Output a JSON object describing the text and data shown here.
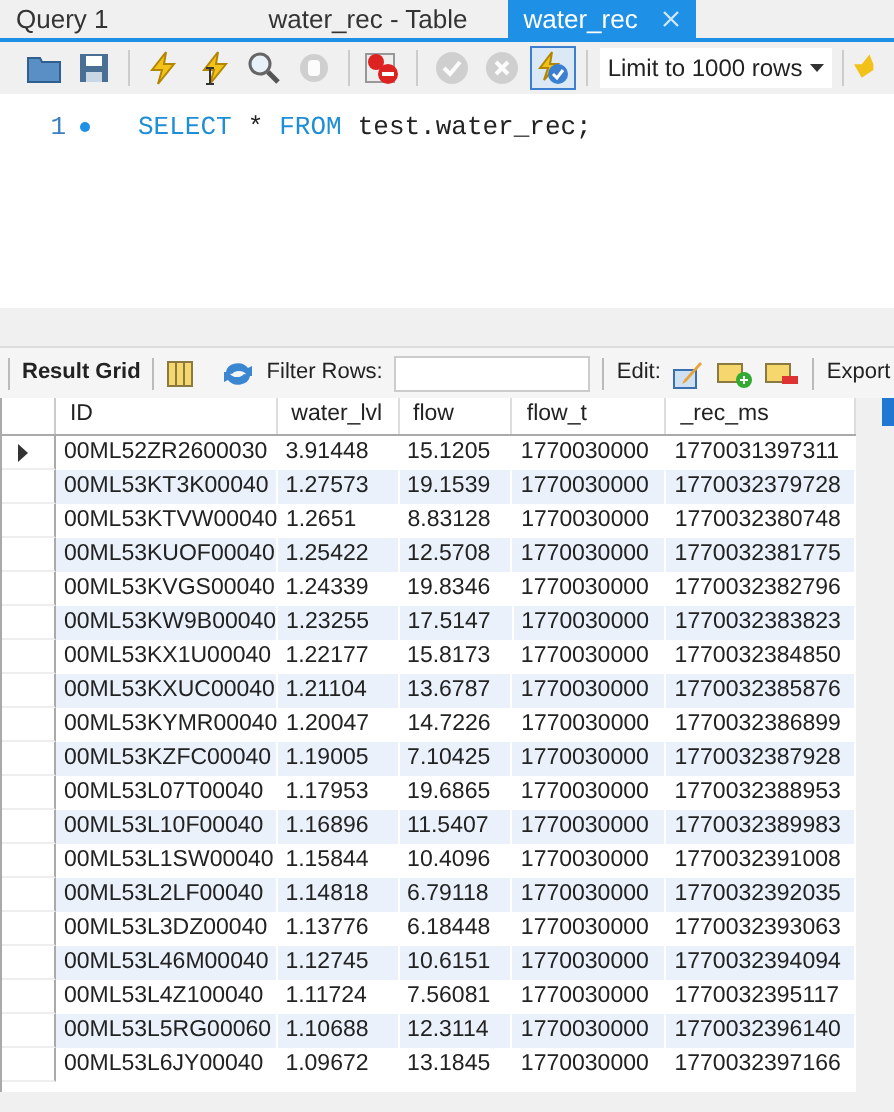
{
  "tabs": [
    {
      "label": "Query 1",
      "selected": false,
      "closable": false
    },
    {
      "label": "water_rec - Table",
      "selected": false,
      "closable": false
    },
    {
      "label": "water_rec",
      "selected": true,
      "closable": true
    }
  ],
  "toolbar": [
    {
      "kind": "folder",
      "disabled": false,
      "selected": false
    },
    {
      "kind": "save",
      "disabled": false,
      "selected": false
    },
    {
      "kind": "sep"
    },
    {
      "kind": "execute",
      "disabled": false,
      "selected": false
    },
    {
      "kind": "execute-current",
      "disabled": false,
      "selected": false
    },
    {
      "kind": "explain",
      "disabled": false,
      "selected": false
    },
    {
      "kind": "stop",
      "disabled": true,
      "selected": false
    },
    {
      "kind": "sep"
    },
    {
      "kind": "error-toggle",
      "disabled": false,
      "selected": false
    },
    {
      "kind": "sep"
    },
    {
      "kind": "commit",
      "disabled": true,
      "selected": false
    },
    {
      "kind": "rollback",
      "disabled": true,
      "selected": false
    },
    {
      "kind": "autocommit",
      "disabled": false,
      "selected": true
    },
    {
      "kind": "sep"
    }
  ],
  "limit_dropdown": {
    "value": "Limit to 1000 rows"
  },
  "editor": {
    "lines": [
      {
        "number": "1",
        "tokens": [
          {
            "text": "SELECT",
            "kind": "keyword"
          },
          {
            "text": "*",
            "kind": "plain"
          },
          {
            "text": "FROM",
            "kind": "keyword"
          },
          {
            "text": "test.water_rec;",
            "kind": "plain"
          }
        ]
      }
    ]
  },
  "result_toolbar": {
    "result_grid": "Result Grid",
    "filter_label": "Filter Rows:",
    "edit_label": "Edit:",
    "export_label": "Export"
  },
  "table": {
    "columns": [
      "ID",
      "water_lvl",
      "flow",
      "flow_t",
      "_rec_ms"
    ],
    "rows": [
      {
        "selected": true,
        "cells": [
          "00ML52ZR2600030",
          "3.91448",
          "15.1205",
          "1770030000",
          "1770031397311"
        ]
      },
      {
        "selected": false,
        "cells": [
          "00ML53KT3K00040",
          "1.27573",
          "19.1539",
          "1770030000",
          "1770032379728"
        ]
      },
      {
        "selected": false,
        "cells": [
          "00ML53KTVW00040",
          "1.2651",
          "8.83128",
          "1770030000",
          "1770032380748"
        ]
      },
      {
        "selected": false,
        "cells": [
          "00ML53KUOF00040",
          "1.25422",
          "12.5708",
          "1770030000",
          "1770032381775"
        ]
      },
      {
        "selected": false,
        "cells": [
          "00ML53KVGS00040",
          "1.24339",
          "19.8346",
          "1770030000",
          "1770032382796"
        ]
      },
      {
        "selected": false,
        "cells": [
          "00ML53KW9B00040",
          "1.23255",
          "17.5147",
          "1770030000",
          "1770032383823"
        ]
      },
      {
        "selected": false,
        "cells": [
          "00ML53KX1U00040",
          "1.22177",
          "15.8173",
          "1770030000",
          "1770032384850"
        ]
      },
      {
        "selected": false,
        "cells": [
          "00ML53KXUC00040",
          "1.21104",
          "13.6787",
          "1770030000",
          "1770032385876"
        ]
      },
      {
        "selected": false,
        "cells": [
          "00ML53KYMR00040",
          "1.20047",
          "14.7226",
          "1770030000",
          "1770032386899"
        ]
      },
      {
        "selected": false,
        "cells": [
          "00ML53KZFC00040",
          "1.19005",
          "7.10425",
          "1770030000",
          "1770032387928"
        ]
      },
      {
        "selected": false,
        "cells": [
          "00ML53L07T00040",
          "1.17953",
          "19.6865",
          "1770030000",
          "1770032388953"
        ]
      },
      {
        "selected": false,
        "cells": [
          "00ML53L10F00040",
          "1.16896",
          "11.5407",
          "1770030000",
          "1770032389983"
        ]
      },
      {
        "selected": false,
        "cells": [
          "00ML53L1SW00040",
          "1.15844",
          "10.4096",
          "1770030000",
          "1770032391008"
        ]
      },
      {
        "selected": false,
        "cells": [
          "00ML53L2LF00040",
          "1.14818",
          "6.79118",
          "1770030000",
          "1770032392035"
        ]
      },
      {
        "selected": false,
        "cells": [
          "00ML53L3DZ00040",
          "1.13776",
          "6.18448",
          "1770030000",
          "1770032393063"
        ]
      },
      {
        "selected": false,
        "cells": [
          "00ML53L46M00040",
          "1.12745",
          "10.6151",
          "1770030000",
          "1770032394094"
        ]
      },
      {
        "selected": false,
        "cells": [
          "00ML53L4Z100040",
          "1.11724",
          "7.56081",
          "1770030000",
          "1770032395117"
        ]
      },
      {
        "selected": false,
        "cells": [
          "00ML53L5RG00060",
          "1.10688",
          "12.3114",
          "1770030000",
          "1770032396140"
        ]
      },
      {
        "selected": false,
        "cells": [
          "00ML53L6JY00040",
          "1.09672",
          "13.1845",
          "1770030000",
          "1770032397166"
        ]
      }
    ]
  }
}
